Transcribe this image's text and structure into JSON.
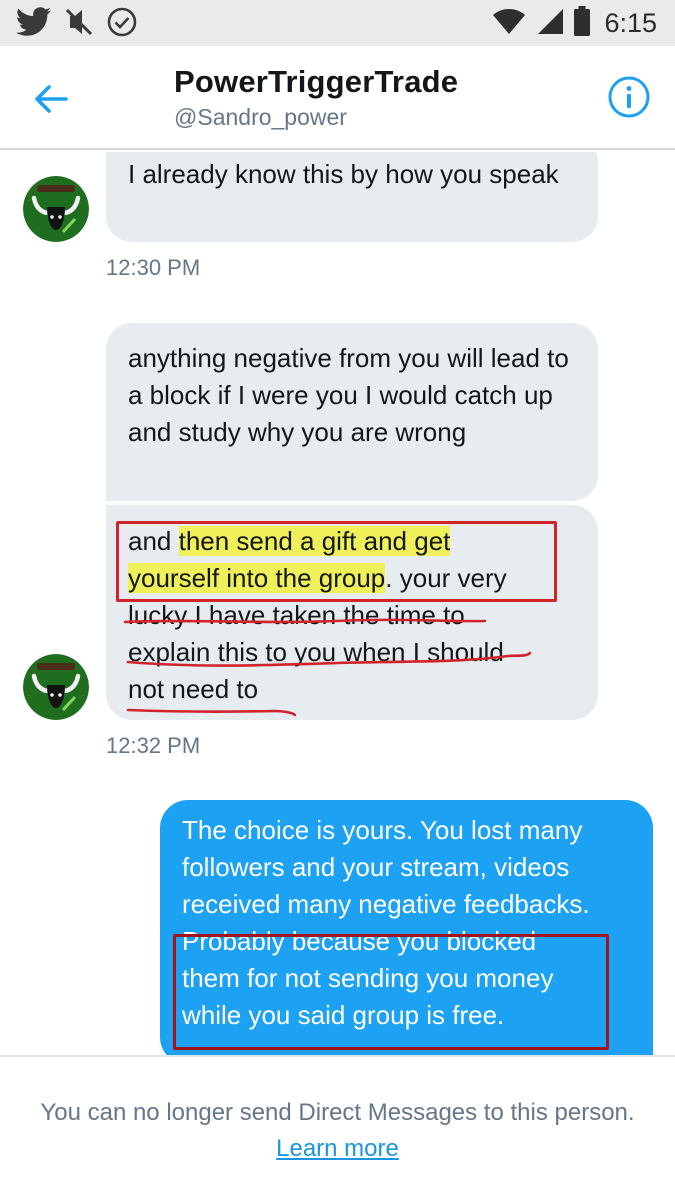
{
  "status_bar": {
    "icons": [
      "twitter-icon",
      "mute-icon",
      "check-circle-icon",
      "wifi-icon",
      "signal-icon",
      "battery-icon"
    ],
    "time": "6:15"
  },
  "header": {
    "back_icon": "arrow-left-icon",
    "title": "PowerTriggerTrade",
    "handle": "@Sandro_power",
    "info_icon": "info-icon"
  },
  "messages": [
    {
      "direction": "incoming",
      "text": "I already know this by how you speak"
    },
    {
      "timestamp": "12:30 PM"
    },
    {
      "direction": "incoming",
      "text": "anything negative from you will lead to a block if I were you I would catch up and study why you are wrong"
    },
    {
      "direction": "incoming",
      "text": "and then send a gift and get yourself into the group. your very lucky I have taken the time to explain this to you when I should not need to",
      "parts": [
        "and ",
        "then send a gift and get",
        "yourself into the group",
        ". your very",
        "lucky I have taken the time to",
        "explain this to you when I should",
        "not need to"
      ]
    },
    {
      "timestamp": "12:32 PM"
    },
    {
      "direction": "outgoing",
      "text": "The choice is yours.  You lost many followers and your stream, videos received many negative feedbacks. Probably because you blocked them for not sending you money while you said group is free.",
      "lines": [
        "The choice is yours.  You lost many",
        "followers and your stream, videos",
        "received many negative feedbacks.",
        "Probably because you blocked",
        "them for not sending you money",
        "while you said group is free."
      ]
    }
  ],
  "footer": {
    "notice": "You can no longer send Direct Messages to this person.",
    "link": "Learn more"
  },
  "colors": {
    "outgoing_bubble": "#1da1f2",
    "incoming_bubble": "#e6ecf0",
    "accent": "#1b95e0",
    "highlight": "#eff05a",
    "annotation_red": "#d0242b"
  }
}
